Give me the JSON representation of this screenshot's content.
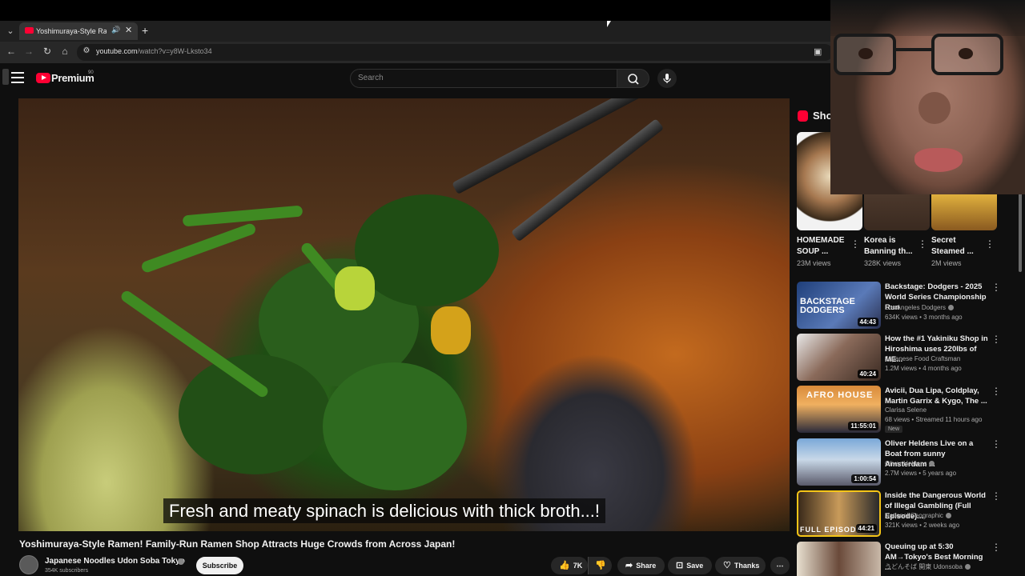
{
  "browser": {
    "tab_title": "Yoshimuraya-Style Ramen!",
    "url_host": "youtube.com",
    "url_path": "/watch?v=y8W-Lksto34",
    "icons": [
      "tab-list-icon",
      "audio-icon",
      "close-icon",
      "new-tab-icon",
      "back-icon",
      "forward-icon",
      "reload-icon",
      "home-icon",
      "site-info-icon",
      "cast-icon"
    ]
  },
  "header": {
    "logo_text": "Premium",
    "logo_sup": "90",
    "search_placeholder": "Search"
  },
  "video": {
    "caption": "Fresh and meaty spinach is delicious with thick broth...!",
    "title": "Yoshimuraya-Style Ramen! Family-Run Ramen Shop Attracts Huge Crowds from Across Japan!",
    "channel": "Japanese Noodles Udon Soba Tokyo",
    "subscribers": "354K subscribers",
    "subscribe_label": "Subscribe",
    "likes": "7K",
    "share_label": "Share",
    "save_label": "Save",
    "thanks_label": "Thanks"
  },
  "shorts": {
    "heading": "Shor",
    "items": [
      {
        "title": "HOMEMADE SOUP ...",
        "views": "23M views"
      },
      {
        "title": "Korea is Banning th...",
        "views": "328K views"
      },
      {
        "title": "Secret Steamed ...",
        "views": "2M views"
      }
    ]
  },
  "recommended": [
    {
      "title": "Backstage: Dodgers - 2025 World Series Championship Run",
      "channel": "Los Angeles Dodgers",
      "meta": "634K views • 3 months ago",
      "duration": "44:43",
      "thumb_text": "BACKSTAGE DODGERS"
    },
    {
      "title": "How the #1 Yakiniku Shop in Hiroshima uses 220lbs of ME...",
      "channel": "Japanese Food Craftsman",
      "meta": "1.2M views • 4 months ago",
      "duration": "40:24",
      "thumb_text": ""
    },
    {
      "title": "Avicii, Dua Lipa, Coldplay, Martin Garrix & Kygo, The ...",
      "channel": "Clarisa Selene",
      "meta": "68 views • Streamed 11 hours ago",
      "duration": "11:55:01",
      "badge": "New",
      "thumb_text": "AFRO HOUSE"
    },
    {
      "title": "Oliver Heldens Live on a Boat from sunny Amsterdam ...",
      "channel": "Oliver Heldens",
      "meta": "2.7M views • 5 years ago",
      "duration": "1:00:54",
      "thumb_text": ""
    },
    {
      "title": "Inside the Dangerous World of Illegal Gambling (Full Episode)...",
      "channel": "National Geographic",
      "meta": "321K views • 2 weeks ago",
      "duration": "44:21",
      "thumb_text": "FULL EPISODE"
    },
    {
      "title": "Queuing up at 5:30 AM→Tokyo's Best Morning ...",
      "channel": "うどんそば 開東 Udonsoba",
      "meta": "",
      "duration": "",
      "thumb_text": ""
    }
  ],
  "colors": {
    "brand": "#ff0033",
    "bg": "#0f0f0f",
    "pill": "#272727"
  }
}
